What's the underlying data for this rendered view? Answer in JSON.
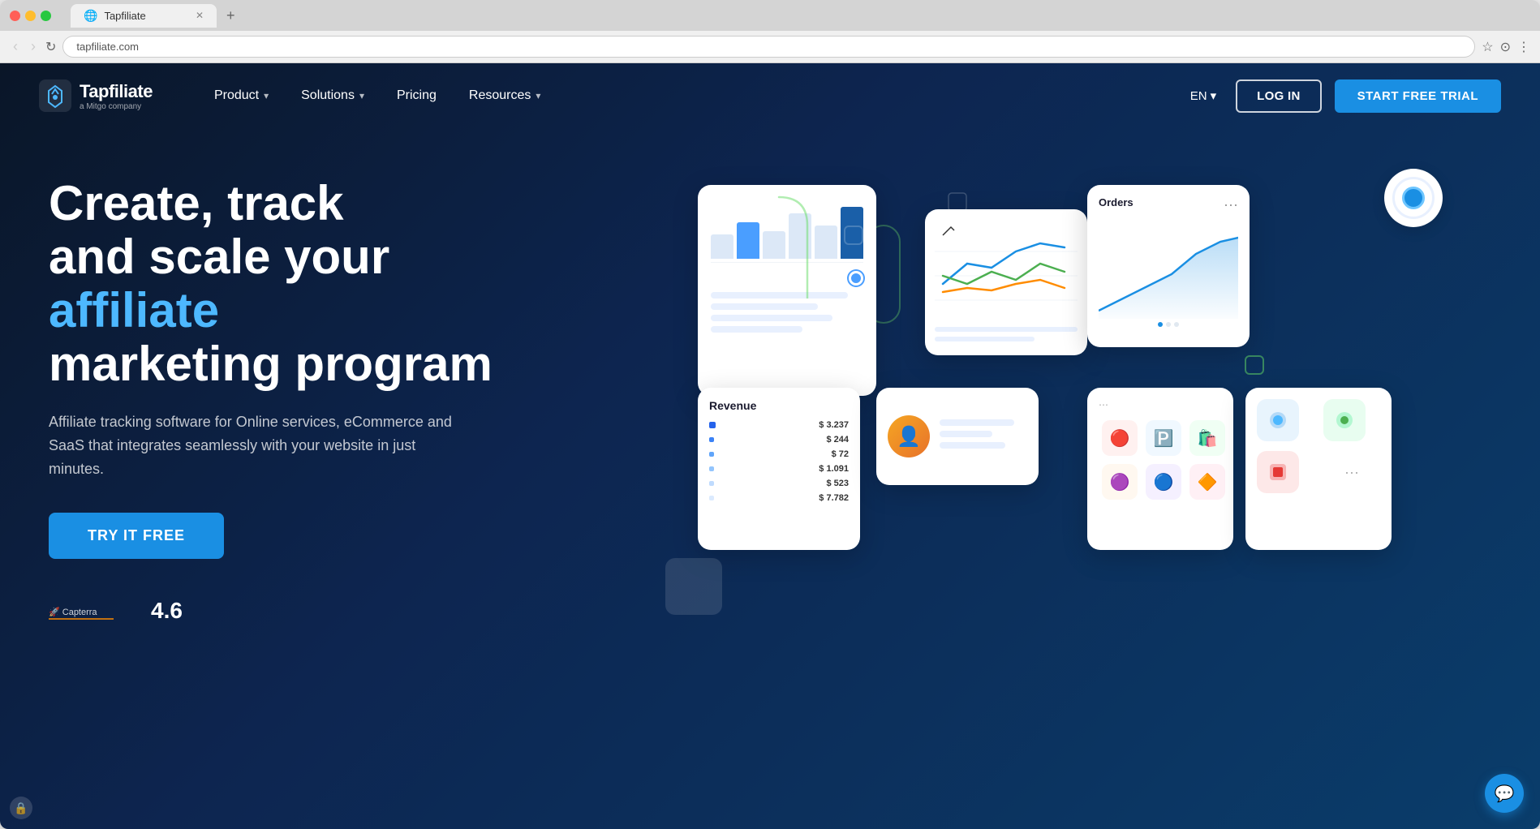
{
  "browser": {
    "tab_icon": "🌐",
    "tab_title": "Tapfiliate",
    "tab_close": "✕",
    "tab_new": "+",
    "back_btn": "‹",
    "forward_btn": "›",
    "refresh_btn": "↻",
    "url": "tapfiliate.com",
    "bookmark_icon": "☆",
    "profile_icon": "⊙",
    "menu_icon": "⋮"
  },
  "nav": {
    "logo_name": "Tapfiliate",
    "logo_sub": "a Mitgo company",
    "product_label": "Product",
    "solutions_label": "Solutions",
    "pricing_label": "Pricing",
    "resources_label": "Resources",
    "lang_label": "EN",
    "login_label": "LOG IN",
    "trial_label": "START FREE TRIAL"
  },
  "hero": {
    "title_line1": "Create, track",
    "title_line2": "and scale your",
    "title_highlight": "affiliate",
    "title_line3": "marketing program",
    "subtitle": "Affiliate tracking software for Online services, eCommerce and SaaS that integrates seamlessly with your website in just minutes.",
    "cta_label": "TRY IT FREE",
    "capterra_label": "Capterra",
    "capterra_rating": "4.6"
  },
  "cards": {
    "revenue_title": "Revenue",
    "revenue_items": [
      {
        "amount": "$ 3.237"
      },
      {
        "amount": "$ 244"
      },
      {
        "amount": "$ 72"
      },
      {
        "amount": "$ 1.091"
      },
      {
        "amount": "$ 523"
      },
      {
        "amount": "$ 7.782"
      }
    ],
    "orders_title": "Orders"
  },
  "colors": {
    "bg_dark": "#0a1628",
    "bg_mid": "#0d2550",
    "accent_blue": "#1a8fe3",
    "accent_light": "#4db8ff",
    "white": "#ffffff"
  }
}
